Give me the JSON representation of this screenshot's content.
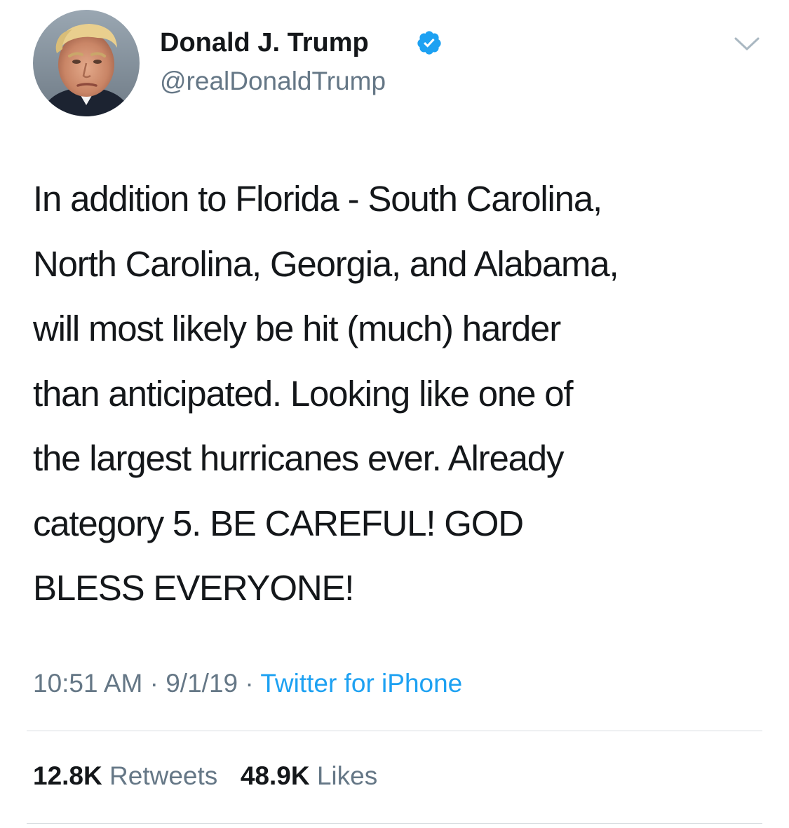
{
  "author": {
    "display_name": "Donald J. Trump",
    "handle": "@realDonaldTrump",
    "verified": true
  },
  "tweet": {
    "text": "In addition to Florida - South Carolina,\nNorth Carolina, Georgia, and Alabama,\nwill most likely be hit (much) harder\nthan anticipated. Looking like one of\nthe largest hurricanes ever. Already\ncategory 5. BE CAREFUL! GOD\nBLESS EVERYONE!",
    "time": "10:51 AM",
    "separator": "·",
    "date": "9/1/19",
    "source": "Twitter for iPhone"
  },
  "stats": {
    "retweets_count": "12.8K",
    "retweets_label": "Retweets",
    "likes_count": "48.9K",
    "likes_label": "Likes"
  },
  "icons": {
    "verified": "verified-badge-icon",
    "menu": "chevron-down-icon"
  },
  "colors": {
    "accent": "#1da1f2",
    "text_primary": "#14171a",
    "text_secondary": "#657786",
    "divider": "#d8dde1"
  }
}
